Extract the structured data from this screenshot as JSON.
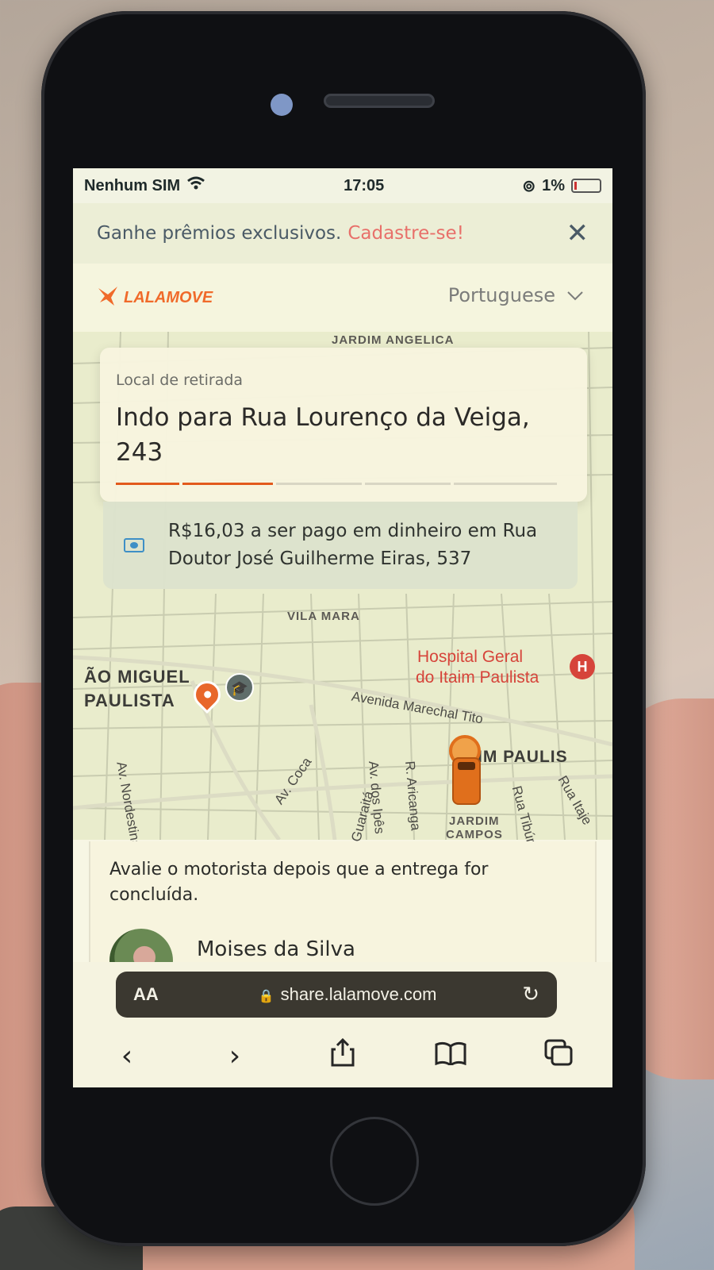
{
  "status_bar": {
    "carrier": "Nenhum SIM",
    "time": "17:05",
    "battery": "1%"
  },
  "promo": {
    "text": "Ganhe prêmios exclusivos.",
    "link": "Cadastre-se!"
  },
  "header": {
    "brand": "LALAMOVE",
    "language": "Portuguese"
  },
  "pickup": {
    "label": "Local de retirada",
    "address": "Indo para Rua Lourenço da Veiga, 243",
    "progress_steps": [
      1,
      1,
      0,
      0,
      0
    ]
  },
  "payment": {
    "text": "R$16,03 a ser pago em dinheiro em Rua Doutor José Guilherme Eiras, 537"
  },
  "map": {
    "labels": {
      "jardim_angelica": "JARDIM ANGELICA",
      "vila_mara": "VILA MARA",
      "sao_miguel_1": "ÃO MIGUEL",
      "sao_miguel_2": "PAULISTA",
      "hospital_1": "Hospital Geral",
      "hospital_2": "do Itaim Paulista",
      "itaim": "IM PAULIS",
      "jardim_campos_1": "JARDIM",
      "jardim_campos_2": "CAMPOS"
    },
    "streets": {
      "marechal": "Avenida Marechal Tito",
      "nordestina": "Av. Nordestina",
      "coca": "Av. Coca",
      "guaraita": "Rua Guaraitá",
      "ipes": "Av. dos Ipês",
      "aricanga": "R. Aricanga",
      "tibur": "Rua Tibúr",
      "itaje": "Rua Itaje"
    }
  },
  "sheet": {
    "rate_text": "Avalie o motorista depois que a entrega for concluída.",
    "driver_name": "Moises da Silva"
  },
  "browser": {
    "aa": "AA",
    "url": "share.lalamove.com"
  },
  "colors": {
    "brand_orange": "#f06a2a",
    "link_red": "#e8706a",
    "progress_orange": "#e25a1c"
  }
}
